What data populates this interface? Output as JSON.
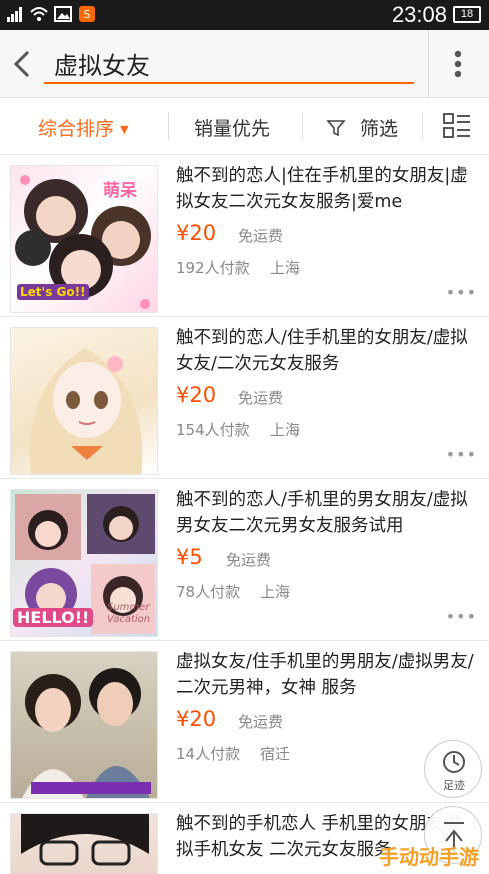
{
  "status_bar": {
    "time": "23:08",
    "battery": "18"
  },
  "header": {
    "search_value": "虚拟女友"
  },
  "sort_bar": {
    "comprehensive": "综合排序",
    "sales": "销量优先",
    "filter": "筛选"
  },
  "items": [
    {
      "title": "触不到的恋人|住在手机里的女朋友|虚拟女友二次元女友服务|爱me",
      "price": "¥20",
      "shipping": "免运费",
      "sold": "192人付款",
      "location": "上海",
      "thumb_text": [
        "萌呆",
        "Let's Go!!"
      ]
    },
    {
      "title": "触不到的恋人/住手机里的女朋友/虚拟女友/二次元女友服务",
      "price": "¥20",
      "shipping": "免运费",
      "sold": "154人付款",
      "location": "上海",
      "thumb_text": []
    },
    {
      "title": "触不到的恋人/手机里的男女朋友/虚拟男女友二次元男女友服务试用",
      "price": "¥5",
      "shipping": "免运费",
      "sold": "78人付款",
      "location": "上海",
      "thumb_text": [
        "HELLO!!",
        "Summer Vacation"
      ]
    },
    {
      "title": "虚拟女友/住手机里的男朋友/虚拟男友/二次元男神，女神 服务",
      "price": "¥20",
      "shipping": "免运费",
      "sold": "14人付款",
      "location": "宿迁",
      "thumb_text": []
    },
    {
      "title": "触不到的手机恋人 手机里的女朋友虚拟手机女友 二次元女友服务",
      "price": "",
      "shipping": "",
      "sold": "",
      "location": "",
      "thumb_text": []
    }
  ],
  "fab": {
    "footprint_label": "足迹"
  },
  "watermark": "手动动手游"
}
